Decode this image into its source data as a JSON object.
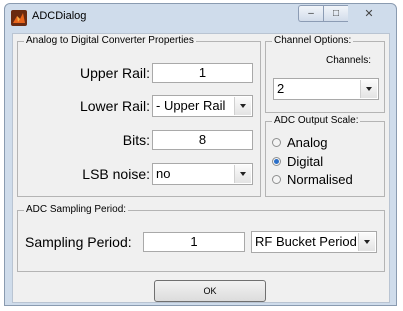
{
  "window": {
    "title": "ADCDialog",
    "min_glyph": "–",
    "max_glyph": "□",
    "close_glyph": "✕"
  },
  "adc_props": {
    "title": "Analog to Digital Converter Properties",
    "upper_rail": {
      "label": "Upper Rail:",
      "value": "1"
    },
    "lower_rail": {
      "label": "Lower Rail:",
      "value": "- Upper Rail"
    },
    "bits": {
      "label": "Bits:",
      "value": "8"
    },
    "lsb_noise": {
      "label": "LSB noise:",
      "value": "no"
    }
  },
  "channel_options": {
    "title": "Channel Options:",
    "channels_label": "Channels:",
    "channels_value": "2"
  },
  "output_scale": {
    "title": "ADC Output Scale:",
    "options": [
      {
        "label": "Analog",
        "selected": false
      },
      {
        "label": "Digital",
        "selected": true
      },
      {
        "label": "Normalised",
        "selected": false
      }
    ]
  },
  "sampling": {
    "title": "ADC Sampling Period:",
    "label": "Sampling Period:",
    "value": "1",
    "unit": "RF Bucket Period"
  },
  "ok_label": "OK",
  "colors": {
    "accent_radio": "#2b6fc8",
    "titlebar": "#cfdceb"
  }
}
